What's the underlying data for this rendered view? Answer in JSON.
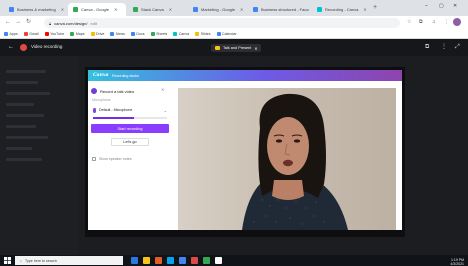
{
  "browser": {
    "tabs": [
      {
        "label": "Business & marketing",
        "favicon_color": "#4285f4"
      },
      {
        "label": "Canva - Google",
        "favicon_color": "#34a853"
      },
      {
        "label": "Stack Canva",
        "favicon_color": "#34a853"
      },
      {
        "label": "Marketing - Google",
        "favicon_color": "#4285f4"
      },
      {
        "label": "Business structured - Faca",
        "favicon_color": "#4285f4"
      },
      {
        "label": "Recording - Canva",
        "favicon_color": "#00c4cc"
      }
    ],
    "new_tab_symbol": "+",
    "window_controls": [
      "–",
      "▢",
      "✕"
    ],
    "omnibox_domain": "canva.com/design/",
    "omnibox_path": "edit",
    "bookmarks": [
      {
        "label": "Apps",
        "color": "#4285f4"
      },
      {
        "label": "Gmail",
        "color": "#ea4335"
      },
      {
        "label": "YouTube",
        "color": "#ff0000"
      },
      {
        "label": "Maps",
        "color": "#34a853"
      },
      {
        "label": "Drive",
        "color": "#fbbc05"
      },
      {
        "label": "News",
        "color": "#4285f4"
      },
      {
        "label": "Docs",
        "color": "#4285f4"
      },
      {
        "label": "Sheets",
        "color": "#34a853"
      },
      {
        "label": "Canva",
        "color": "#00c4cc"
      },
      {
        "label": "Slides",
        "color": "#fbbc05"
      },
      {
        "label": "Calendar",
        "color": "#4285f4"
      }
    ]
  },
  "editor": {
    "title": "Video recording",
    "present_label": "Talk and Present",
    "right_icons": [
      "⧉",
      "⋮",
      "⤢"
    ]
  },
  "recorder": {
    "brand_logo": "Canva",
    "brand_tagline": "Recording studio",
    "heading": "Record a talk video",
    "subheading": "Microphone",
    "mic_device": "Default - Microphone",
    "mic_level_percent": 55,
    "primary_button": "Start recording",
    "secondary_button": "Let's go",
    "option_label": "Show speaker notes"
  },
  "taskbar": {
    "search_placeholder": "Type here to search",
    "apps": [
      "#2b78e4",
      "#f5c518",
      "#e35d2b",
      "#00a4ef",
      "#4285f4",
      "#e04848",
      "#34a853",
      "#ffffff"
    ],
    "time": "1:19 PM",
    "date": "4/3/2021"
  },
  "colors": {
    "canva_purple": "#8b3dff",
    "editor_bg": "#1c1d20"
  }
}
